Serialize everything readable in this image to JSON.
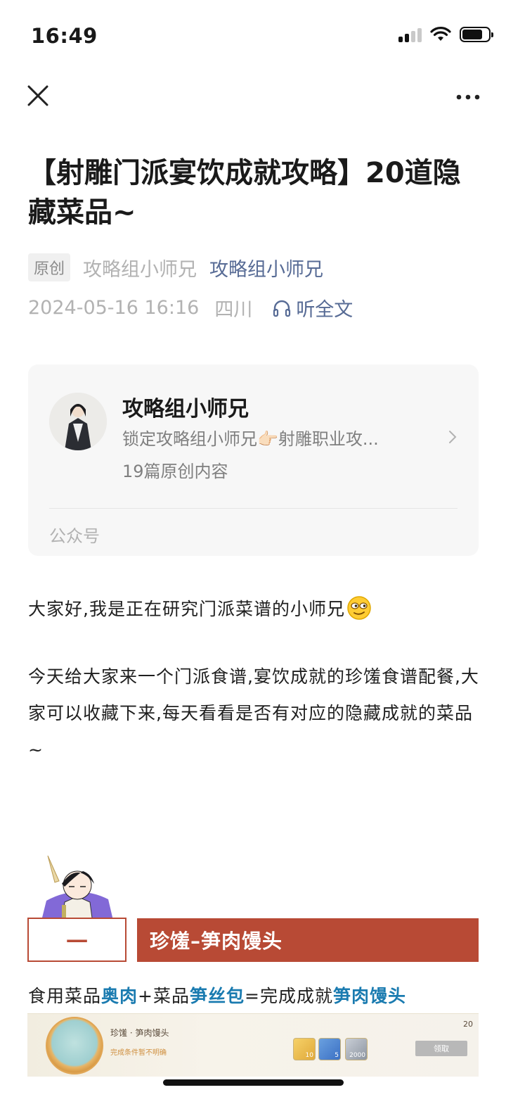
{
  "status_bar": {
    "time": "16:49"
  },
  "nav": {
    "close": "close-icon",
    "more": "more-icon"
  },
  "article": {
    "title": "【射雕门派宴饮成就攻略】20道隐藏菜品~",
    "original_tag": "原创",
    "author": "攻略组小师兄",
    "account": "攻略组小师兄",
    "date": "2024-05-16 16:16",
    "region": "四川",
    "listen_label": "听全文"
  },
  "account_card": {
    "name": "攻略组小师兄",
    "description": "锁定攻略组小师兄👉🏻射雕职业攻...",
    "count": "19篇原创内容",
    "type": "公众号"
  },
  "content": {
    "para1": "大家好,我是正在研究门派菜谱的小师兄",
    "para2": "今天给大家来一个门派食谱,宴饮成就的珍馐食谱配餐,大家可以收藏下来,每天看看是否有对应的隐藏成就的菜品~",
    "section": {
      "number": "一",
      "title": "珍馐–笋肉馒头"
    },
    "recipe": {
      "text1": "食用菜品",
      "item1": "奥肉",
      "plus": "+菜品",
      "item2": "笋丝包",
      "equals": "=完成成就",
      "result": "笋肉馒头"
    },
    "banner": {
      "name": "珍馐 · 笋肉馒头",
      "condition": "完成条件暂不明确",
      "rewards": [
        "10",
        "5",
        "2000"
      ],
      "button": "领取",
      "points": "20"
    }
  },
  "colors": {
    "accent": "#576b95",
    "section": "#b84a35",
    "highlight": "#1a7bb0"
  }
}
